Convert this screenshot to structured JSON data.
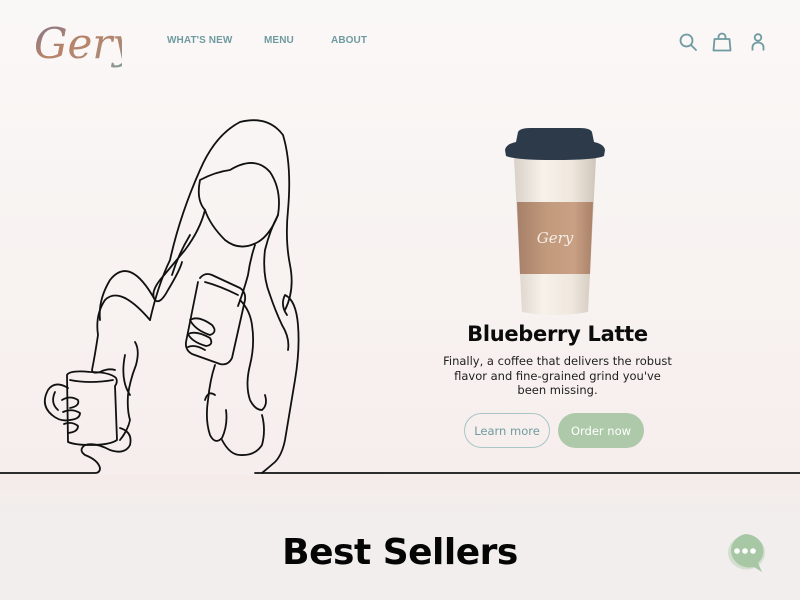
{
  "brand": {
    "logo_text": "Gery",
    "cup_logo_text": "Gery"
  },
  "nav": {
    "items": [
      {
        "label": "WHAT'S NEW"
      },
      {
        "label": "MENU"
      },
      {
        "label": "ABOUT"
      }
    ]
  },
  "header_icons": [
    "search-icon",
    "shopping-bag-icon",
    "user-icon"
  ],
  "hero": {
    "product_title": "Blueberry Latte",
    "product_description": "Finally, a coffee that delivers the robust flavor and fine-grained grind you've been missing.",
    "learn_more_label": "Learn more",
    "order_now_label": "Order now"
  },
  "section": {
    "title": "Best Sellers"
  },
  "colors": {
    "accent_teal": "#6f9ba0",
    "accent_green": "#adc9a9",
    "cup_lid": "#2c3a4a",
    "cup_sleeve": "#c29a7c"
  }
}
